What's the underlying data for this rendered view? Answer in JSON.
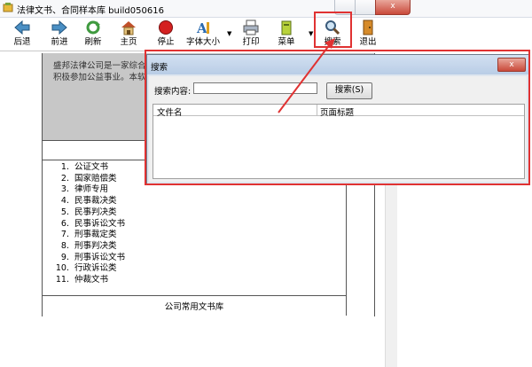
{
  "window": {
    "title": "法律文书、合同样本库 build050616",
    "close_glyph": "x"
  },
  "toolbar": {
    "back": "后退",
    "forward": "前进",
    "refresh": "刷新",
    "home": "主页",
    "stop": "停止",
    "font_size": "字体大小",
    "print": "打印",
    "menu": "菜单",
    "search": "搜索",
    "exit": "退出"
  },
  "document": {
    "intro_text": "盛邦法律公司是一家综合由一群大学历、执业多年、具理了大量的诉讼及非诉讼案件积极参加公益事业。本软件就而成的。",
    "toc": [
      {
        "num": "1.",
        "label": "公证文书"
      },
      {
        "num": "2.",
        "label": "国家赔偿类"
      },
      {
        "num": "3.",
        "label": "律师专用"
      },
      {
        "num": "4.",
        "label": "民事裁决类"
      },
      {
        "num": "5.",
        "label": "民事判决类"
      },
      {
        "num": "6.",
        "label": "民事诉讼文书"
      },
      {
        "num": "7.",
        "label": "刑事裁定类"
      },
      {
        "num": "8.",
        "label": "刑事判决类"
      },
      {
        "num": "9.",
        "label": "刑事诉讼文书"
      },
      {
        "num": "10.",
        "label": "行政诉讼类"
      },
      {
        "num": "11.",
        "label": "仲裁文书"
      }
    ],
    "footer": "公司常用文书库"
  },
  "search_dialog": {
    "title": "搜索",
    "content_label": "搜索内容:",
    "input_value": "",
    "search_button": "搜索(S)",
    "columns": [
      "文件名",
      "页面标题"
    ],
    "close_glyph": "x"
  },
  "colors": {
    "highlight": "#e03232",
    "intro_bg": "#c7c7c7",
    "dialog_caption": "#c8d9ee"
  }
}
